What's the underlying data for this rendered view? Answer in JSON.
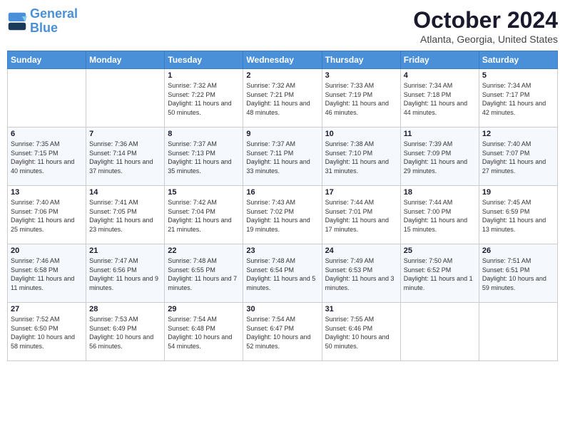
{
  "logo": {
    "line1": "General",
    "line2": "Blue"
  },
  "title": "October 2024",
  "location": "Atlanta, Georgia, United States",
  "days_of_week": [
    "Sunday",
    "Monday",
    "Tuesday",
    "Wednesday",
    "Thursday",
    "Friday",
    "Saturday"
  ],
  "weeks": [
    [
      {
        "day": "",
        "sunrise": "",
        "sunset": "",
        "daylight": ""
      },
      {
        "day": "",
        "sunrise": "",
        "sunset": "",
        "daylight": ""
      },
      {
        "day": "1",
        "sunrise": "Sunrise: 7:32 AM",
        "sunset": "Sunset: 7:22 PM",
        "daylight": "Daylight: 11 hours and 50 minutes."
      },
      {
        "day": "2",
        "sunrise": "Sunrise: 7:32 AM",
        "sunset": "Sunset: 7:21 PM",
        "daylight": "Daylight: 11 hours and 48 minutes."
      },
      {
        "day": "3",
        "sunrise": "Sunrise: 7:33 AM",
        "sunset": "Sunset: 7:19 PM",
        "daylight": "Daylight: 11 hours and 46 minutes."
      },
      {
        "day": "4",
        "sunrise": "Sunrise: 7:34 AM",
        "sunset": "Sunset: 7:18 PM",
        "daylight": "Daylight: 11 hours and 44 minutes."
      },
      {
        "day": "5",
        "sunrise": "Sunrise: 7:34 AM",
        "sunset": "Sunset: 7:17 PM",
        "daylight": "Daylight: 11 hours and 42 minutes."
      }
    ],
    [
      {
        "day": "6",
        "sunrise": "Sunrise: 7:35 AM",
        "sunset": "Sunset: 7:15 PM",
        "daylight": "Daylight: 11 hours and 40 minutes."
      },
      {
        "day": "7",
        "sunrise": "Sunrise: 7:36 AM",
        "sunset": "Sunset: 7:14 PM",
        "daylight": "Daylight: 11 hours and 37 minutes."
      },
      {
        "day": "8",
        "sunrise": "Sunrise: 7:37 AM",
        "sunset": "Sunset: 7:13 PM",
        "daylight": "Daylight: 11 hours and 35 minutes."
      },
      {
        "day": "9",
        "sunrise": "Sunrise: 7:37 AM",
        "sunset": "Sunset: 7:11 PM",
        "daylight": "Daylight: 11 hours and 33 minutes."
      },
      {
        "day": "10",
        "sunrise": "Sunrise: 7:38 AM",
        "sunset": "Sunset: 7:10 PM",
        "daylight": "Daylight: 11 hours and 31 minutes."
      },
      {
        "day": "11",
        "sunrise": "Sunrise: 7:39 AM",
        "sunset": "Sunset: 7:09 PM",
        "daylight": "Daylight: 11 hours and 29 minutes."
      },
      {
        "day": "12",
        "sunrise": "Sunrise: 7:40 AM",
        "sunset": "Sunset: 7:07 PM",
        "daylight": "Daylight: 11 hours and 27 minutes."
      }
    ],
    [
      {
        "day": "13",
        "sunrise": "Sunrise: 7:40 AM",
        "sunset": "Sunset: 7:06 PM",
        "daylight": "Daylight: 11 hours and 25 minutes."
      },
      {
        "day": "14",
        "sunrise": "Sunrise: 7:41 AM",
        "sunset": "Sunset: 7:05 PM",
        "daylight": "Daylight: 11 hours and 23 minutes."
      },
      {
        "day": "15",
        "sunrise": "Sunrise: 7:42 AM",
        "sunset": "Sunset: 7:04 PM",
        "daylight": "Daylight: 11 hours and 21 minutes."
      },
      {
        "day": "16",
        "sunrise": "Sunrise: 7:43 AM",
        "sunset": "Sunset: 7:02 PM",
        "daylight": "Daylight: 11 hours and 19 minutes."
      },
      {
        "day": "17",
        "sunrise": "Sunrise: 7:44 AM",
        "sunset": "Sunset: 7:01 PM",
        "daylight": "Daylight: 11 hours and 17 minutes."
      },
      {
        "day": "18",
        "sunrise": "Sunrise: 7:44 AM",
        "sunset": "Sunset: 7:00 PM",
        "daylight": "Daylight: 11 hours and 15 minutes."
      },
      {
        "day": "19",
        "sunrise": "Sunrise: 7:45 AM",
        "sunset": "Sunset: 6:59 PM",
        "daylight": "Daylight: 11 hours and 13 minutes."
      }
    ],
    [
      {
        "day": "20",
        "sunrise": "Sunrise: 7:46 AM",
        "sunset": "Sunset: 6:58 PM",
        "daylight": "Daylight: 11 hours and 11 minutes."
      },
      {
        "day": "21",
        "sunrise": "Sunrise: 7:47 AM",
        "sunset": "Sunset: 6:56 PM",
        "daylight": "Daylight: 11 hours and 9 minutes."
      },
      {
        "day": "22",
        "sunrise": "Sunrise: 7:48 AM",
        "sunset": "Sunset: 6:55 PM",
        "daylight": "Daylight: 11 hours and 7 minutes."
      },
      {
        "day": "23",
        "sunrise": "Sunrise: 7:48 AM",
        "sunset": "Sunset: 6:54 PM",
        "daylight": "Daylight: 11 hours and 5 minutes."
      },
      {
        "day": "24",
        "sunrise": "Sunrise: 7:49 AM",
        "sunset": "Sunset: 6:53 PM",
        "daylight": "Daylight: 11 hours and 3 minutes."
      },
      {
        "day": "25",
        "sunrise": "Sunrise: 7:50 AM",
        "sunset": "Sunset: 6:52 PM",
        "daylight": "Daylight: 11 hours and 1 minute."
      },
      {
        "day": "26",
        "sunrise": "Sunrise: 7:51 AM",
        "sunset": "Sunset: 6:51 PM",
        "daylight": "Daylight: 10 hours and 59 minutes."
      }
    ],
    [
      {
        "day": "27",
        "sunrise": "Sunrise: 7:52 AM",
        "sunset": "Sunset: 6:50 PM",
        "daylight": "Daylight: 10 hours and 58 minutes."
      },
      {
        "day": "28",
        "sunrise": "Sunrise: 7:53 AM",
        "sunset": "Sunset: 6:49 PM",
        "daylight": "Daylight: 10 hours and 56 minutes."
      },
      {
        "day": "29",
        "sunrise": "Sunrise: 7:54 AM",
        "sunset": "Sunset: 6:48 PM",
        "daylight": "Daylight: 10 hours and 54 minutes."
      },
      {
        "day": "30",
        "sunrise": "Sunrise: 7:54 AM",
        "sunset": "Sunset: 6:47 PM",
        "daylight": "Daylight: 10 hours and 52 minutes."
      },
      {
        "day": "31",
        "sunrise": "Sunrise: 7:55 AM",
        "sunset": "Sunset: 6:46 PM",
        "daylight": "Daylight: 10 hours and 50 minutes."
      },
      {
        "day": "",
        "sunrise": "",
        "sunset": "",
        "daylight": ""
      },
      {
        "day": "",
        "sunrise": "",
        "sunset": "",
        "daylight": ""
      }
    ]
  ]
}
